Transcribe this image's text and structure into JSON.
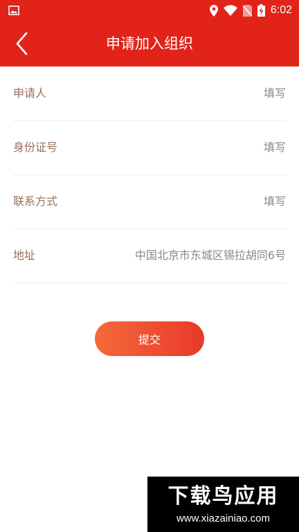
{
  "status_bar": {
    "time": "6:02",
    "icons": [
      "image-icon",
      "location-icon",
      "wifi-icon",
      "no-sim-icon",
      "battery-charging-icon"
    ]
  },
  "header": {
    "title": "申请加入组织",
    "back_icon": "chevron-left-icon"
  },
  "form": {
    "fields": [
      {
        "label": "申请人",
        "placeholder": "填写",
        "value": ""
      },
      {
        "label": "身份证号",
        "placeholder": "填写",
        "value": ""
      },
      {
        "label": "联系方式",
        "placeholder": "填写",
        "value": ""
      },
      {
        "label": "地址",
        "placeholder": "",
        "value": "中国北京市东城区锡拉胡同6号"
      }
    ],
    "submit_label": "提交"
  },
  "watermark": {
    "brand": "下载鸟应用",
    "url": "www.xiazainiao.com"
  },
  "colors": {
    "primary": "#e2231a",
    "label": "#9b6e5a",
    "value": "#888888",
    "button_gradient_start": "#f46a3a",
    "button_gradient_end": "#e8392a"
  }
}
